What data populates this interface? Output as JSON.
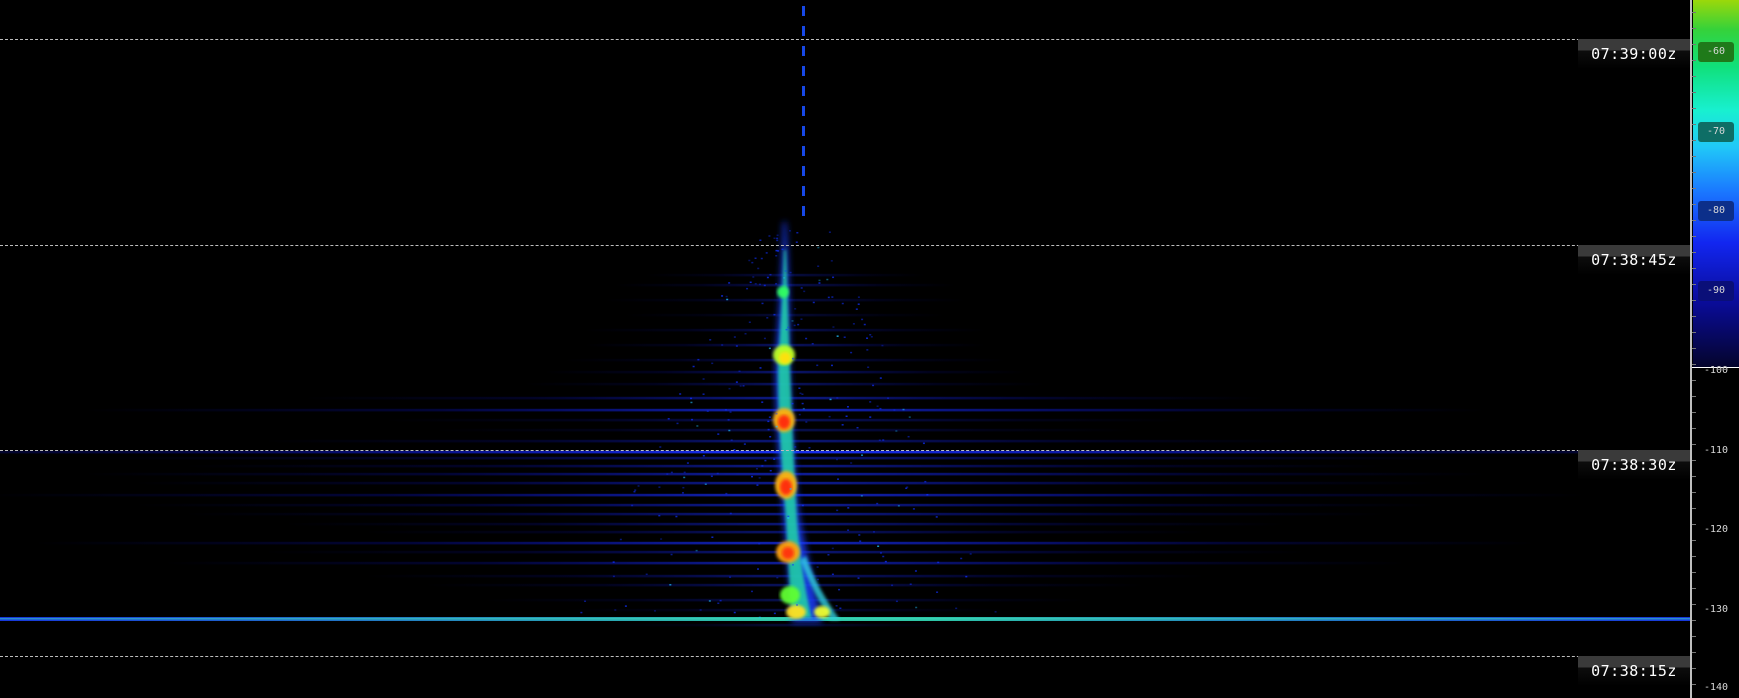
{
  "waterfall": {
    "time_labels": [
      "07:39:00z",
      "07:38:45z",
      "07:38:30z",
      "07:38:15z"
    ]
  },
  "level_scale": {
    "ticks": [
      "-60",
      "-70",
      "-80",
      "-90",
      "-100",
      "-110",
      "-120",
      "-130",
      "-140"
    ],
    "tick_colors": [
      "#1f7a1a",
      "#0e6e66",
      "#0c2f8a",
      "#0a0f78",
      "",
      "",
      "",
      "",
      ""
    ]
  },
  "colors": {
    "background": "#000000",
    "grid_line": "#bdbdbd",
    "signal_low": "#0a14e8",
    "signal_mid": "#18e03c",
    "signal_high": "#ff2a10"
  }
}
